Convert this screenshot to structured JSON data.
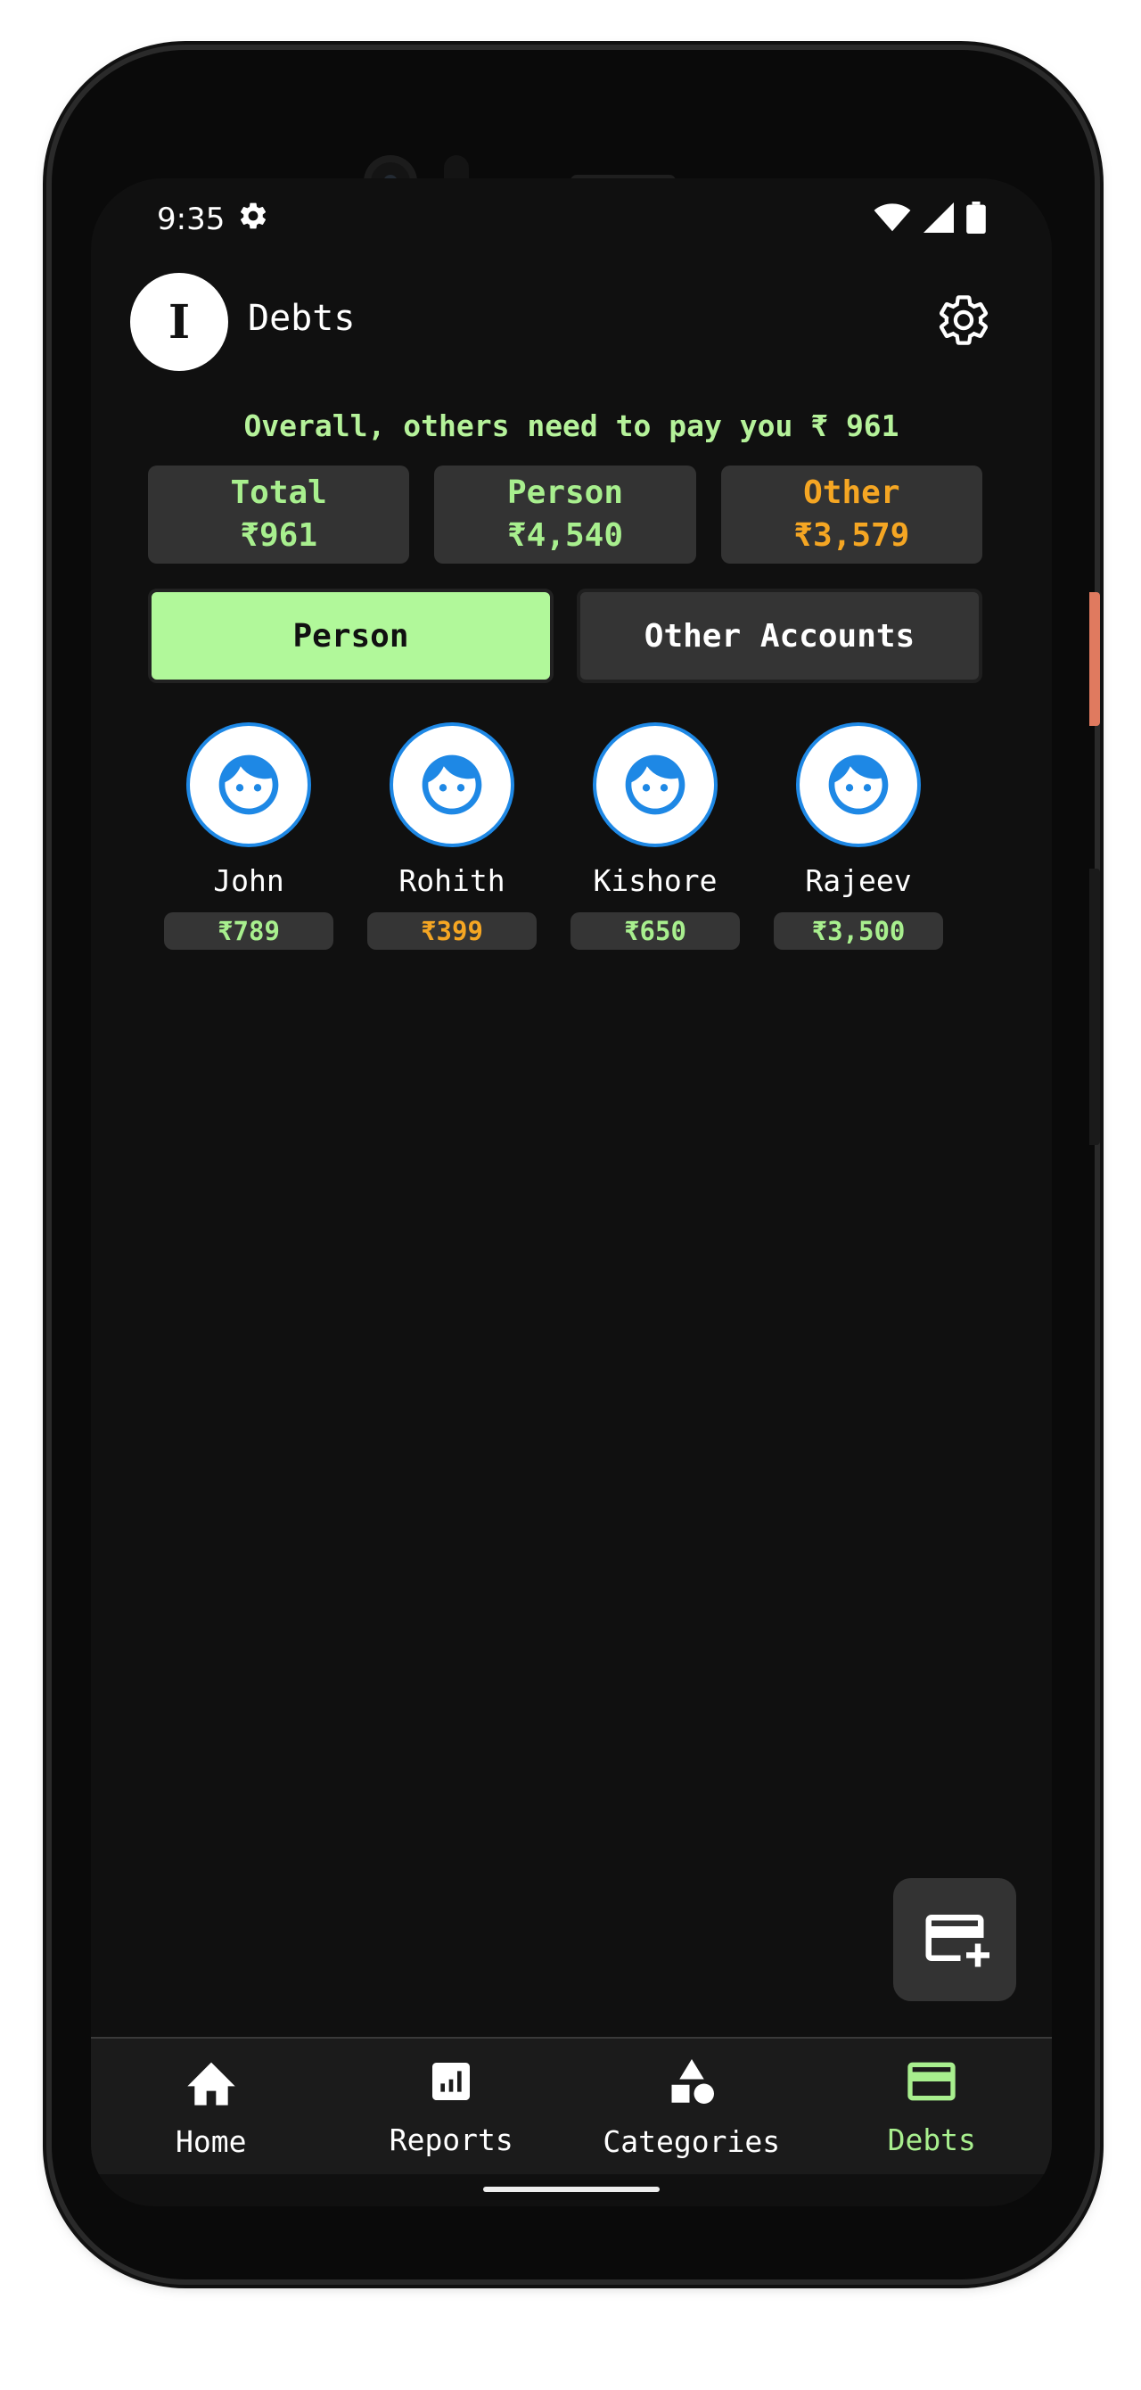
{
  "status_bar": {
    "time": "9:35",
    "icons": [
      "gear-icon",
      "wifi-icon",
      "signal-icon",
      "battery-icon"
    ]
  },
  "header": {
    "avatar_letter": "I",
    "title": "Debts",
    "settings_icon": "gear-icon"
  },
  "summary": {
    "overall_text": "Overall, others need to pay you ₹ 961",
    "cards": [
      {
        "label": "Total",
        "value": "₹961",
        "color": "#a8ef8e"
      },
      {
        "label": "Person",
        "value": "₹4,540",
        "color": "#a8ef8e"
      },
      {
        "label": "Other",
        "value": "₹3,579",
        "color": "#f5a623"
      }
    ]
  },
  "toggle": {
    "person_label": "Person",
    "other_label": "Other Accounts",
    "selected": "Person"
  },
  "people": [
    {
      "name": "John",
      "amount": "₹789",
      "color": "#a8ef8e"
    },
    {
      "name": "Rohith",
      "amount": "₹399",
      "color": "#f5a623"
    },
    {
      "name": "Kishore",
      "amount": "₹650",
      "color": "#a8ef8e"
    },
    {
      "name": "Rajeev",
      "amount": "₹3,500",
      "color": "#a8ef8e"
    }
  ],
  "fab": {
    "icon": "add-card-icon"
  },
  "bottom_nav": [
    {
      "label": "Home",
      "icon": "home-icon"
    },
    {
      "label": "Reports",
      "icon": "bar-chart-icon"
    },
    {
      "label": "Categories",
      "icon": "shapes-icon"
    },
    {
      "label": "Debts",
      "icon": "credit-card-icon",
      "active": true
    }
  ],
  "colors": {
    "accent_green": "#a8ef8e",
    "accent_orange": "#f5a623",
    "avatar_blue": "#1e88e5"
  }
}
